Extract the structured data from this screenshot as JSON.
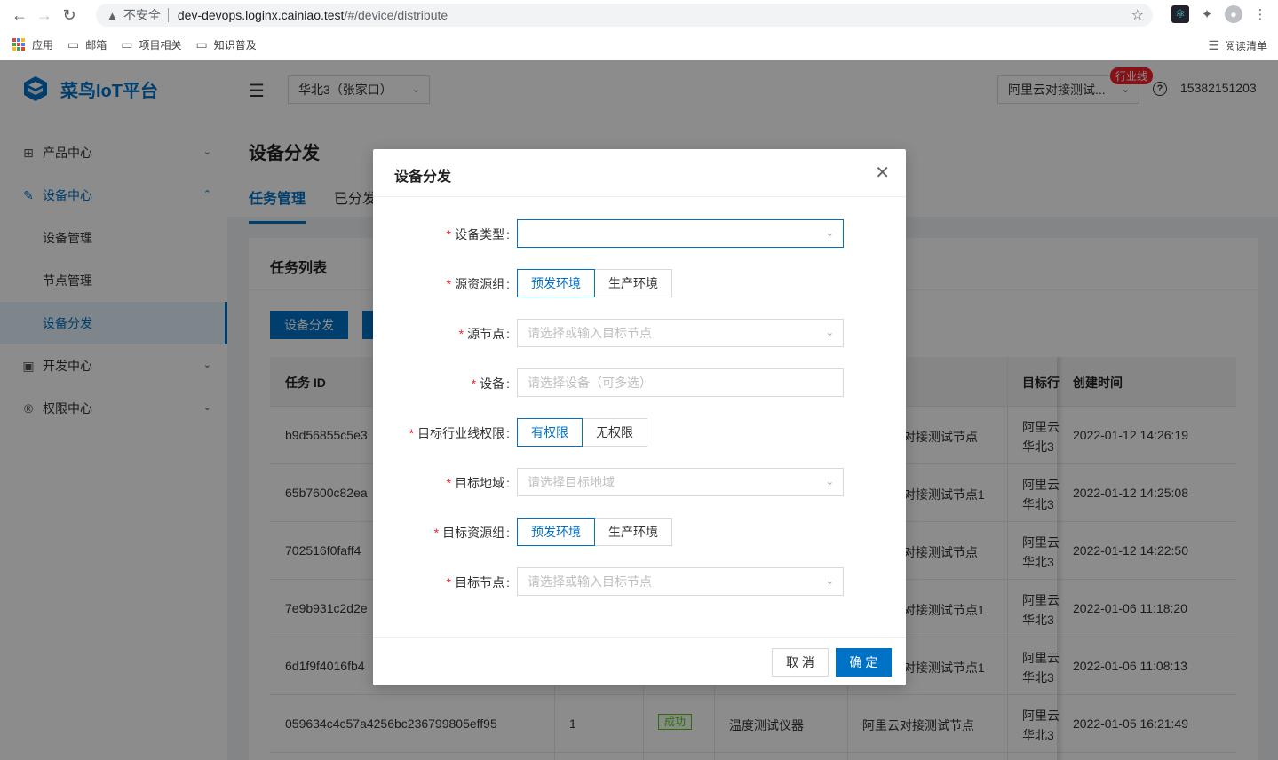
{
  "browser": {
    "insecure_label": "不安全",
    "url_host": "dev-devops.loginx.cainiao.test",
    "url_path": "/#/device/distribute",
    "bookmarks": [
      "应用",
      "邮箱",
      "项目相关",
      "知识普及"
    ],
    "reading_list": "阅读清单"
  },
  "app": {
    "logo_text": "菜鸟IoT平台",
    "menu": {
      "product": "产品中心",
      "device": "设备中心",
      "device_mgmt": "设备管理",
      "node_mgmt": "节点管理",
      "device_dist": "设备分发",
      "dev": "开发中心",
      "auth": "权限中心"
    },
    "header": {
      "region": "华北3（张家口）",
      "line": "阿里云对接测试...",
      "line_badge": "行业线",
      "phone": "15382151203"
    },
    "page": {
      "title": "设备分发",
      "tabs": [
        "任务管理",
        "已分发"
      ]
    },
    "card": {
      "title": "任务列表",
      "button": "设备分发"
    },
    "table": {
      "headers": {
        "id": "任务 ID",
        "target_line": "目标行",
        "created": "创建时间"
      },
      "rows": [
        {
          "id": "b9d56855c5e3",
          "count": "",
          "status": "",
          "type": "",
          "src": "对接测试节点",
          "tgt1": "阿里云",
          "tgt2": "华北3",
          "time": "2022-01-12 14:26:19"
        },
        {
          "id": "65b7600c82ea",
          "count": "",
          "status": "",
          "type": "",
          "src": "对接测试节点1",
          "tgt1": "阿里云",
          "tgt2": "华北3",
          "time": "2022-01-12 14:25:08"
        },
        {
          "id": "702516f0faff4",
          "count": "",
          "status": "",
          "type": "",
          "src": "对接测试节点",
          "tgt1": "阿里云",
          "tgt2": "华北3",
          "time": "2022-01-12 14:22:50"
        },
        {
          "id": "7e9b931c2d2e",
          "count": "",
          "status": "",
          "type": "",
          "src": "对接测试节点1",
          "tgt1": "阿里云",
          "tgt2": "华北3",
          "time": "2022-01-06 11:18:20"
        },
        {
          "id": "6d1f9f4016fb4",
          "count": "",
          "status": "",
          "type": "",
          "src": "对接测试节点1",
          "tgt1": "阿里云",
          "tgt2": "华北3",
          "time": "2022-01-06 11:08:13"
        },
        {
          "id": "059634c4c57a4256bc236799805eff95",
          "count": "1",
          "status": "成功",
          "type": "温度测试仪器",
          "src": "阿里云对接测试节点",
          "tgt1": "阿里云",
          "tgt2": "华北3",
          "time": "2022-01-05 16:21:49"
        }
      ]
    }
  },
  "modal": {
    "title": "设备分发",
    "fields": {
      "device_type": {
        "label": "设备类型",
        "placeholder": ""
      },
      "src_group": {
        "label": "源资源组",
        "options": [
          "预发环境",
          "生产环境"
        ],
        "selected": "预发环境"
      },
      "src_node": {
        "label": "源节点",
        "placeholder": "请选择或输入目标节点"
      },
      "device": {
        "label": "设备",
        "placeholder": "请选择设备（可多选）"
      },
      "tgt_perm": {
        "label": "目标行业线权限",
        "options": [
          "有权限",
          "无权限"
        ],
        "selected": "有权限"
      },
      "tgt_region": {
        "label": "目标地域",
        "placeholder": "请选择目标地域"
      },
      "tgt_group": {
        "label": "目标资源组",
        "options": [
          "预发环境",
          "生产环境"
        ],
        "selected": "预发环境"
      },
      "tgt_node": {
        "label": "目标节点",
        "placeholder": "请选择或输入目标节点"
      }
    },
    "cancel": "取 消",
    "ok": "确 定"
  },
  "colors": {
    "primary": "#0072c6",
    "required": "#f5222d",
    "success": "#52c41a"
  },
  "icons": [
    "back-icon",
    "forward-icon",
    "reload-icon",
    "warning-icon",
    "star-icon",
    "react-devtools-icon",
    "puzzle-icon",
    "profile-icon",
    "kebab-icon",
    "folder-icon",
    "apps-icon",
    "reading-list-icon",
    "product-icon",
    "wrench-icon",
    "terminal-icon",
    "registered-icon",
    "chevron-down-icon",
    "menu-fold-icon",
    "help-icon",
    "close-icon"
  ]
}
